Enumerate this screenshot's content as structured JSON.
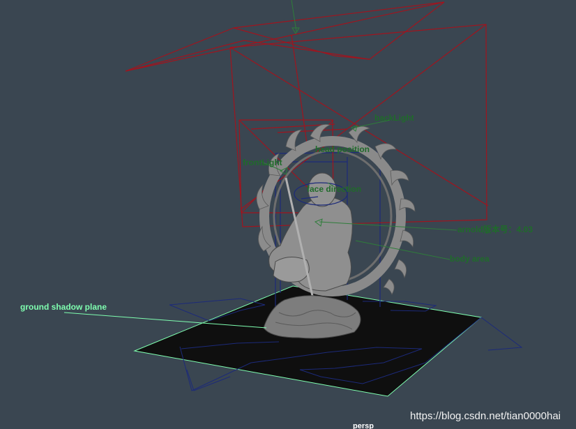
{
  "viewport": {
    "camera_name": "persp",
    "background_color": "#3a4651"
  },
  "annotations": {
    "back_light": "backLight",
    "front_light": "frontLight",
    "head_position": "head position",
    "face_direction": "face direction",
    "arnold_version": "arnold版本号：4.03",
    "body_area": "body area",
    "ground_shadow_plane": "ground shadow plane"
  },
  "watermark": "https://blog.csdn.net/tian0000hai",
  "colors": {
    "light_wireframe": "#a0141e",
    "locator_wireframe": "#1c2a7a",
    "annotation_text": "#1f6b2a",
    "selected_annotation": "#7fffb0",
    "ground_plane_fill": "#0f0f0f",
    "ground_plane_outline": "#7fffb0",
    "statue": "#8a8a8a"
  }
}
